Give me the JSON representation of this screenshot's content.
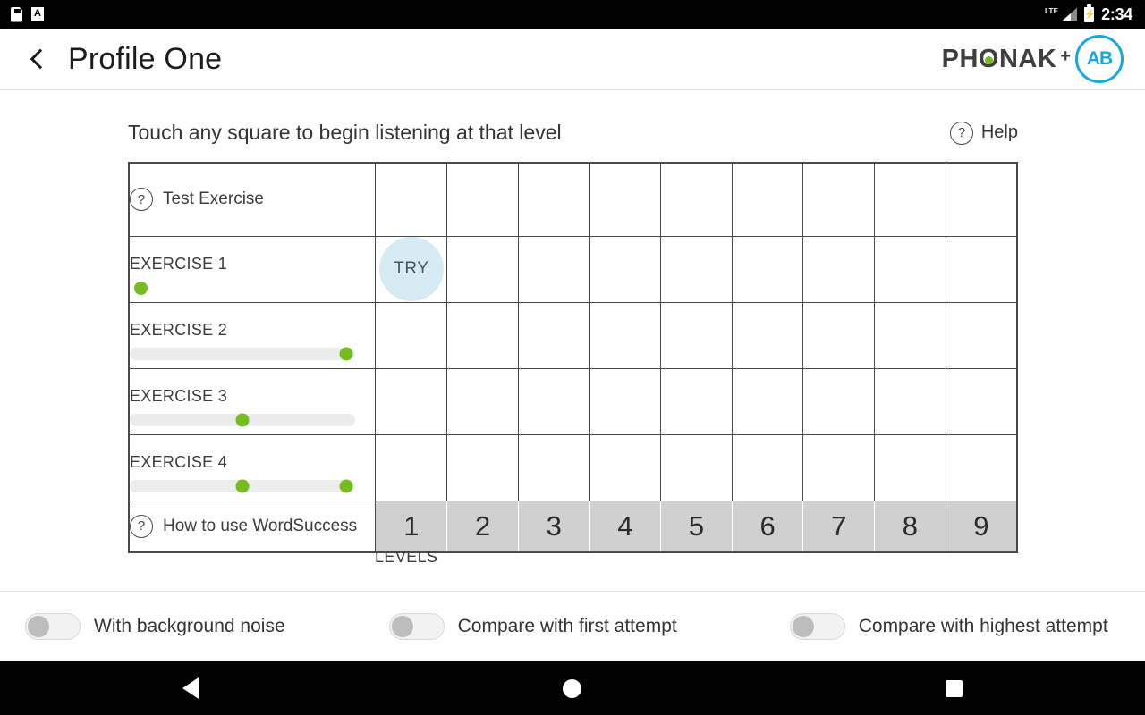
{
  "status_bar": {
    "icons_left": [
      "sd-card-icon",
      "keyboard-input-icon"
    ],
    "network_label": "LTE",
    "icons_right": [
      "signal-icon",
      "battery-charging-icon"
    ],
    "time": "2:34"
  },
  "header": {
    "back_icon": "chevron-left-icon",
    "title": "Profile One",
    "brand": {
      "phonak": "PHONAK",
      "plus": "+",
      "ab": "AB",
      "accent_color": "#17a8e3",
      "dot_color": "#76bc21"
    }
  },
  "main": {
    "instruction": "Touch any square to begin listening at that level",
    "help": {
      "icon": "question-mark-icon",
      "label": "Help"
    },
    "levels_caption": "LEVELS",
    "levels": [
      "1",
      "2",
      "3",
      "4",
      "5",
      "6",
      "7",
      "8",
      "9"
    ],
    "try_label": "TRY",
    "rows": [
      {
        "id": "test-exercise",
        "type": "help-row",
        "icon": "question-mark-icon",
        "label": "Test Exercise"
      },
      {
        "id": "exercise-1",
        "type": "exercise",
        "label": "EXERCISE 1",
        "indicator": "dot-only",
        "dots": [],
        "active_level": 1
      },
      {
        "id": "exercise-2",
        "type": "exercise",
        "label": "EXERCISE 2",
        "indicator": "track",
        "dots": [
          96
        ]
      },
      {
        "id": "exercise-3",
        "type": "exercise",
        "label": "EXERCISE 3",
        "indicator": "track",
        "dots": [
          50
        ]
      },
      {
        "id": "exercise-4",
        "type": "exercise",
        "label": "EXERCISE 4",
        "indicator": "track",
        "dots": [
          50,
          96
        ]
      },
      {
        "id": "how-to-use",
        "type": "help-row",
        "icon": "question-mark-icon",
        "label": "How to use WordSuccess"
      }
    ]
  },
  "toggles": [
    {
      "id": "background-noise",
      "label": "With background noise",
      "on": false
    },
    {
      "id": "compare-first",
      "label": "Compare with first attempt",
      "on": false
    },
    {
      "id": "compare-highest",
      "label": "Compare with highest attempt",
      "on": false
    }
  ],
  "nav_bar": {
    "back": "back-triangle-icon",
    "home": "home-circle-icon",
    "recents": "recents-square-icon"
  },
  "colors": {
    "green": "#76bc21",
    "try_bg": "#d5ecf4",
    "level_bg": "#d0d0d0",
    "track_bg": "#ececed"
  }
}
